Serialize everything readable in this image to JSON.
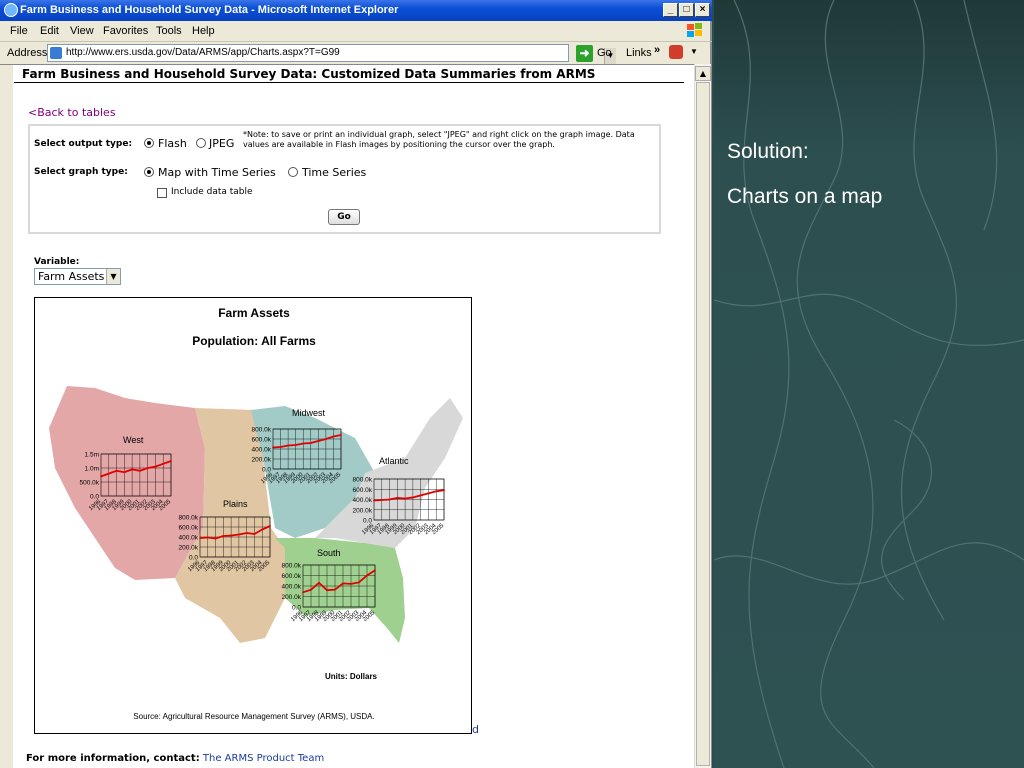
{
  "window": {
    "title": "Farm Business and Household Survey Data - Microsoft Internet Explorer",
    "menu": [
      "File",
      "Edit",
      "View",
      "Favorites",
      "Tools",
      "Help"
    ],
    "address_label": "Address",
    "url": "http://www.ers.usda.gov/Data/ARMS/app/Charts.aspx?T=G99",
    "go_label": "Go",
    "links_label": "Links"
  },
  "page": {
    "header": "Farm Business and Household Survey Data: Customized Data Summaries from ARMS",
    "back_link": "<Back to tables",
    "output_type_label": "Select output type:",
    "output_options": [
      "Flash",
      "JPEG"
    ],
    "output_selected": "Flash",
    "note": "*Note: to save or print an individual graph, select \"JPEG\" and right click on the graph image. Data values are available in Flash images by positioning the cursor over the graph.",
    "graph_type_label": "Select graph type:",
    "graph_options": [
      "Map with Time Series",
      "Time Series"
    ],
    "graph_selected": "Map with Time Series",
    "include_table_label": "Include data table",
    "include_table_checked": false,
    "go_button": "Go",
    "variable_label": "Variable:",
    "variable_value": "Farm Assets",
    "stray_char": "d",
    "footer_label": "For more information, contact:",
    "footer_link": "The ARMS Product Team"
  },
  "chart_data": {
    "type": "line",
    "title": "Farm Assets",
    "subtitle": "Population: All Farms",
    "units": "Units: Dollars",
    "source": "Source: Agricultural Resource Management Survey (ARMS), USDA.",
    "x": [
      1996,
      1997,
      1998,
      1999,
      2000,
      2001,
      2002,
      2003,
      2004,
      2005
    ],
    "regions": [
      {
        "name": "West",
        "yticks": [
          "1.5m",
          "1.0m",
          "500.0k",
          "0.0"
        ],
        "ymax": 1500000,
        "values": [
          700000,
          800000,
          900000,
          850000,
          950000,
          900000,
          1000000,
          1050000,
          1150000,
          1250000
        ]
      },
      {
        "name": "Midwest",
        "yticks": [
          "800.0k",
          "600.0k",
          "400.0k",
          "200.0k",
          "0.0"
        ],
        "ymax": 800000,
        "values": [
          430000,
          440000,
          470000,
          480000,
          510000,
          520000,
          560000,
          600000,
          650000,
          680000
        ]
      },
      {
        "name": "Atlantic",
        "yticks": [
          "800.0k",
          "600.0k",
          "400.0k",
          "200.0k",
          "0.0"
        ],
        "ymax": 800000,
        "values": [
          380000,
          390000,
          400000,
          430000,
          420000,
          440000,
          480000,
          520000,
          560000,
          580000
        ]
      },
      {
        "name": "Plains",
        "yticks": [
          "800.0k",
          "600.0k",
          "400.0k",
          "200.0k",
          "0.0"
        ],
        "ymax": 800000,
        "values": [
          380000,
          390000,
          370000,
          420000,
          430000,
          450000,
          480000,
          460000,
          550000,
          620000
        ]
      },
      {
        "name": "South",
        "yticks": [
          "800.0k",
          "600.0k",
          "400.0k",
          "200.0k",
          "0.0"
        ],
        "ymax": 800000,
        "values": [
          280000,
          330000,
          460000,
          320000,
          330000,
          450000,
          440000,
          470000,
          600000,
          700000
        ]
      }
    ],
    "ylim": [
      0,
      null
    ],
    "grid": true
  },
  "slide": {
    "line1": "Solution:",
    "line2": "Charts on a map"
  },
  "colors": {
    "west": "#e3a7a7",
    "plains": "#e1c6a4",
    "midwest": "#a2cac7",
    "atlantic": "#d8d8d8",
    "south": "#9fd08f",
    "series": "#e00000"
  }
}
